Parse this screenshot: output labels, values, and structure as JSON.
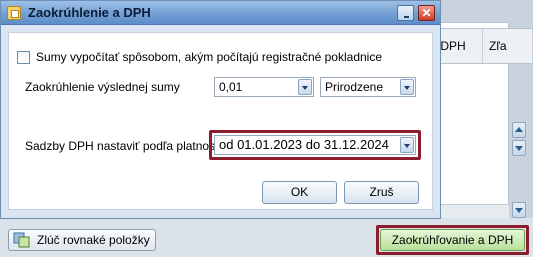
{
  "background": {
    "tabs": [
      "s DPH",
      "Zľa"
    ],
    "merge_button": "Zlúč rovnaké položky",
    "rounding_button": "Zaokrúhľovanie a DPH"
  },
  "dialog": {
    "title": "Zaokrúhlenie a DPH",
    "checkbox_label": "Sumy vypočítať spôsobom, akým počítajú registračné pokladnice",
    "rounding_label": "Zaokrúhlenie výslednej sumy",
    "rounding_value": "0,01",
    "rounding_method": "Prirodzene",
    "vat_label": "Sadzby DPH nastaviť podľa platnosti",
    "vat_value": "od 01.01.2023 do 31.12.2024",
    "ok_label": "OK",
    "cancel_label": "Zruš"
  },
  "colors": {
    "highlight": "#8b1c2b",
    "titlebar": "#6f9dd3"
  }
}
